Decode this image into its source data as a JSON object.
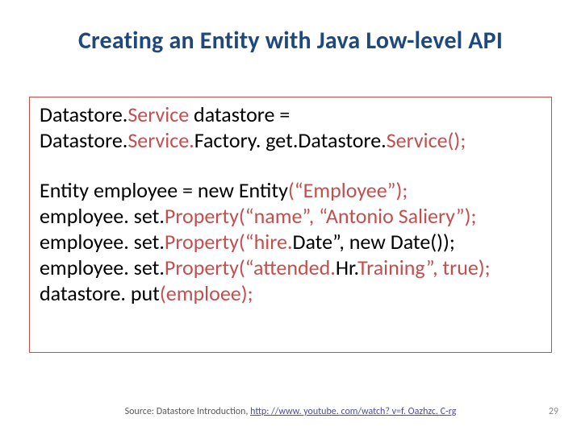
{
  "title": "Creating an Entity with Java Low-level API",
  "code": {
    "block1": {
      "l1_a": "Datastore.",
      "l1_b": "Service ",
      "l1_c": "datastore = ",
      "l2_a": "Datastore.",
      "l2_b": "Service.",
      "l2_c": "Factory. get.",
      "l2_d": "Datastore.",
      "l2_e": "Service();"
    },
    "block2": {
      "l1_a": "Entity employee = new Entity",
      "l1_b": "(“Employee”);",
      "l2_a": "employee. set.",
      "l2_b": "Property(“name”, “Antonio Saliery”);",
      "l3_a": "employee. set.",
      "l3_b": "Property(“hire.",
      "l3_c": "Date”, new Date());",
      "l4_a": "employee. set.",
      "l4_b": "Property(“attended.",
      "l4_c": "Hr.",
      "l4_d": "Training”, true);",
      "l5_a": "datastore. put",
      "l5_b": "(emploee);"
    }
  },
  "footer": {
    "prefix": "Source: Datastore Introduction, ",
    "link_text": "http: //www. youtube. com/watch? v=f. Oazhzc. C-rg",
    "link_href": "http://www.youtube.com/watch?v=fOazhzcC-rg"
  },
  "page_number": "29"
}
